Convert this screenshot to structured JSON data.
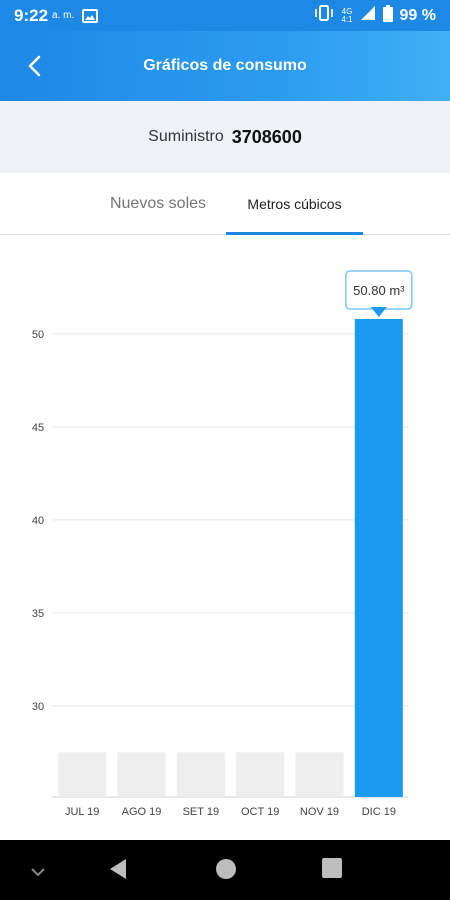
{
  "status_bar": {
    "time": "9:22",
    "ampm": "a. m.",
    "network_top": "4G",
    "network_bottom": "4:1",
    "battery": "99 %",
    "icons": [
      "gallery-icon",
      "vibrate-icon",
      "signal-icon",
      "battery-icon"
    ]
  },
  "app_bar": {
    "title": "Gráficos de consumo",
    "back_icon": "chevron-left-icon"
  },
  "supply": {
    "label": "Suministro",
    "number": "3708600"
  },
  "tabs": [
    {
      "label": "Nuevos soles",
      "active": false
    },
    {
      "label": "Metros cúbicos",
      "active": true
    }
  ],
  "colors": {
    "primary": "#1e88e5",
    "bar_active": "#1a9bef",
    "bar_inactive": "#eeeeee",
    "grid": "#e6e6e6"
  },
  "chart_data": {
    "type": "bar",
    "categories": [
      "JUL 19",
      "AGO 19",
      "SET 19",
      "OCT 19",
      "NOV 19",
      "DIC 19"
    ],
    "values": [
      27.5,
      27.5,
      27.5,
      27.5,
      27.5,
      50.8
    ],
    "highlighted_index": 5,
    "y_ticks": [
      30,
      35,
      40,
      45,
      50
    ],
    "ylim": [
      25.1,
      52.5
    ],
    "tooltip": "50.80 m³",
    "grid": true
  },
  "nav_bar": {
    "icons": [
      "chevron-down-icon",
      "back-triangle-icon",
      "home-circle-icon",
      "recents-square-icon"
    ]
  }
}
